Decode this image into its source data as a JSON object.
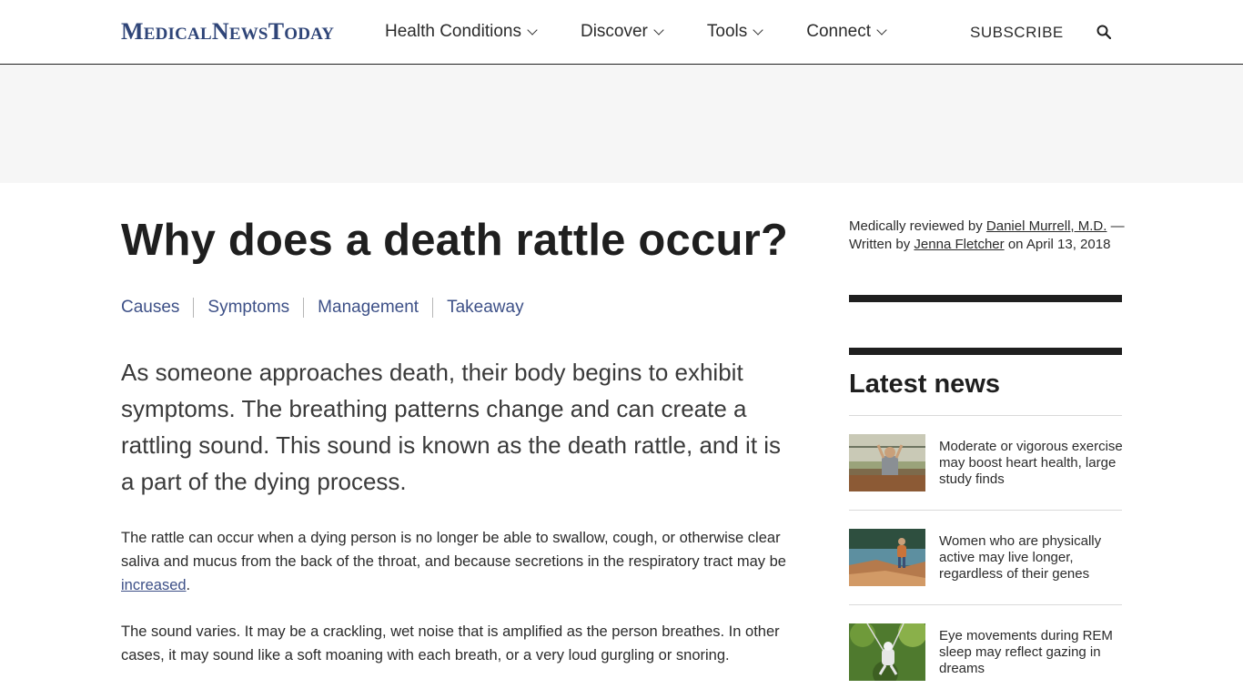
{
  "header": {
    "logo": {
      "w1_cap": "M",
      "w1_rest": "EDICAL",
      "w2_cap": "N",
      "w2_rest": "EWS",
      "w3_cap": "T",
      "w3_rest": "ODAY"
    },
    "nav": [
      {
        "label": "Health Conditions"
      },
      {
        "label": "Discover"
      },
      {
        "label": "Tools"
      },
      {
        "label": "Connect"
      }
    ],
    "subscribe_label": "SUBSCRIBE",
    "search_icon": "search-icon"
  },
  "article": {
    "title": "Why does a death rattle occur?",
    "toc": [
      "Causes",
      "Symptoms",
      "Management",
      "Takeaway"
    ],
    "lead": "As someone approaches death, their body begins to exhibit symptoms. The breathing patterns change and can create a rattling sound. This sound is known as the death rattle, and it is a part of the dying process.",
    "para1_text": "The rattle can occur when a dying person is no longer be able to swallow, cough, or otherwise clear saliva and mucus from the back of the throat, and because secretions in the respiratory tract may be ",
    "para1_link": "increased",
    "para1_end": ".",
    "para2": "The sound varies. It may be a crackling, wet noise that is amplified as the person breathes. In other cases, it may sound like a soft moaning with each breath, or a very loud gurgling or snoring."
  },
  "sidebar": {
    "reviewed_prefix": "Medically reviewed by ",
    "reviewer": "Daniel Murrell, M.D.",
    "written_prefix": " — Written by ",
    "author": "Jenna Fletcher",
    "date_text": " on April 13, 2018",
    "latest_title": "Latest news",
    "news": [
      {
        "headline": "Moderate or vigorous exercise may boost heart health, large study finds"
      },
      {
        "headline": "Women who are physically active may live longer, regardless of their genes"
      },
      {
        "headline": "Eye movements during REM sleep may reflect gazing in dreams"
      }
    ]
  },
  "colors": {
    "brand": "#2f4578",
    "link": "#3d5087",
    "text": "#1f1f1f",
    "ad_band": "#f6f6f6"
  }
}
